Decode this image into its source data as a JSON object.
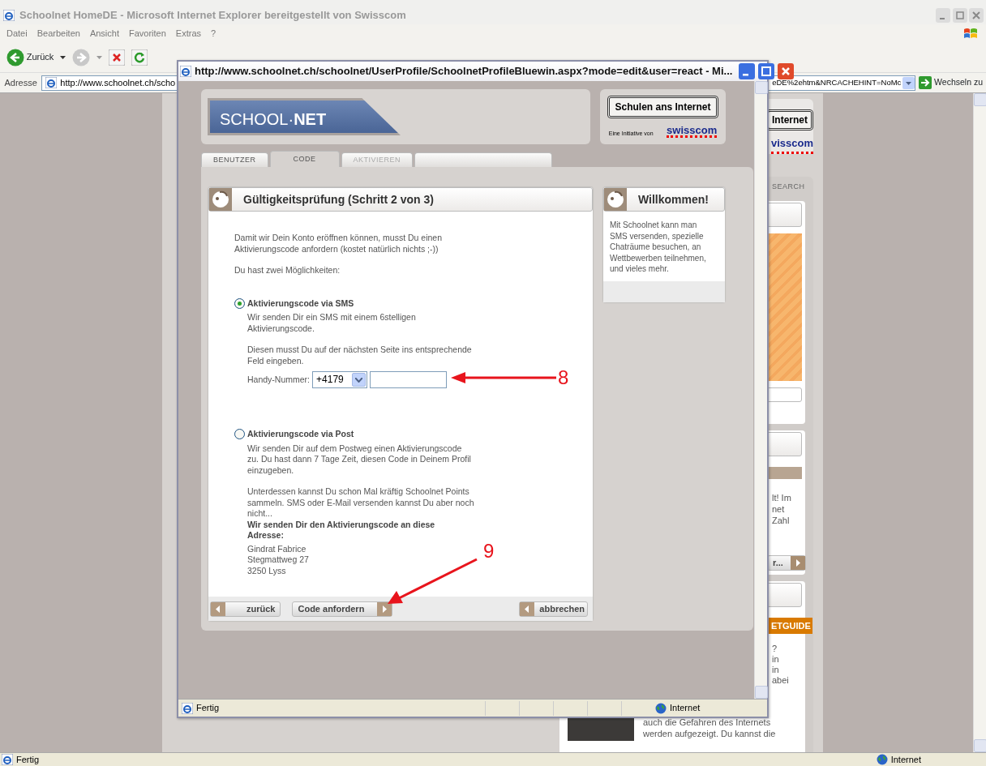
{
  "browser": {
    "title": "Schoolnet HomeDE - Microsoft Internet Explorer bereitgestellt von Swisscom",
    "menu": [
      "Datei",
      "Bearbeiten",
      "Ansicht",
      "Favoriten",
      "Extras",
      "?"
    ],
    "back_label": "Zurück",
    "address": {
      "label": "Adresse",
      "url_start": "http://www.schoolnet.ch/scho",
      "url_end": "eDE%2ehtm&NRCACHEHINT=NoMc",
      "go_label": "Wechseln zu"
    },
    "status": {
      "text": "Fertig",
      "zone": "Internet"
    }
  },
  "background_page": {
    "header_button": "Internet",
    "logo_text": "visscom",
    "tab": "SEARCH",
    "news_lines": [
      "lt! Im",
      "net",
      "Zahl"
    ],
    "news_button": "r...",
    "guide_banner": "ETGUIDE",
    "guide_lines": [
      "?",
      "in",
      "in",
      "abei"
    ],
    "guide_text_lines": [
      "auch die Gefahren des Internets",
      "werden aufgezeigt. Du kannst die"
    ]
  },
  "popup": {
    "title": "http://www.schoolnet.ch/schoolnet/UserProfile/SchoolnetProfileBluewin.aspx?mode=edit&user=react - Mi...",
    "logo": "SCHOOL·**NET**",
    "header_button": "Schulen ans Internet",
    "initiative": "Eine Initiative von",
    "brand": "swisscom",
    "tabs": [
      {
        "label": "BENUTZER",
        "selected": false,
        "disabled": false
      },
      {
        "label": "CODE",
        "selected": true,
        "disabled": false
      },
      {
        "label": "AKTIVIEREN",
        "selected": false,
        "disabled": true
      }
    ],
    "main": {
      "title": "Gültigkeitsprüfung (Schritt 2 von 3)",
      "intro": [
        "Damit wir Dein Konto eröffnen können, musst Du einen Aktivierungscode anfordern (kostet natürlich nichts ;-))",
        "Du hast zwei Möglichkeiten:"
      ],
      "options": [
        {
          "title": "Aktivierungscode via SMS",
          "selected": true,
          "paragraphs": [
            "Wir senden Dir ein SMS mit einem 6stelligen Aktivierungscode.",
            "Diesen musst Du auf der nächsten Seite ins entsprechende Feld eingeben."
          ],
          "phone": {
            "label": "Handy-Nummer:",
            "prefix": "+4179"
          }
        },
        {
          "title": "Aktivierungscode via Post",
          "selected": false,
          "paragraphs": [
            "Wir senden Dir auf dem Postweg einen Aktivierungscode zu. Du hast dann 7 Tage Zeit, diesen Code in Deinem Profil einzugeben.",
            "Unterdessen kannst Du schon Mal kräftig Schoolnet Points sammeln. SMS oder E-Mail versenden kannst Du aber noch nicht..."
          ],
          "address": {
            "heading": "Wir senden Dir den Aktivierungscode an diese Adresse:",
            "lines": [
              "Gindrat Fabrice",
              "Stegmattweg 27",
              "3250 Lyss"
            ]
          }
        }
      ],
      "buttons": [
        {
          "label": "zurück",
          "kind": "back"
        },
        {
          "label": "Code anfordern",
          "kind": "forward"
        },
        {
          "label": "abbrechen",
          "kind": "back"
        }
      ]
    },
    "sidebar": {
      "title": "Willkommen!",
      "text": "Mit Schoolnet kann man SMS versenden, spezielle Chaträume besuchen, an Wettbewerben teilnehmen, und vieles mehr."
    },
    "status": {
      "text": "Fertig",
      "zone": "Internet"
    }
  },
  "annotations": [
    {
      "label": "8"
    },
    {
      "label": "9"
    }
  ]
}
